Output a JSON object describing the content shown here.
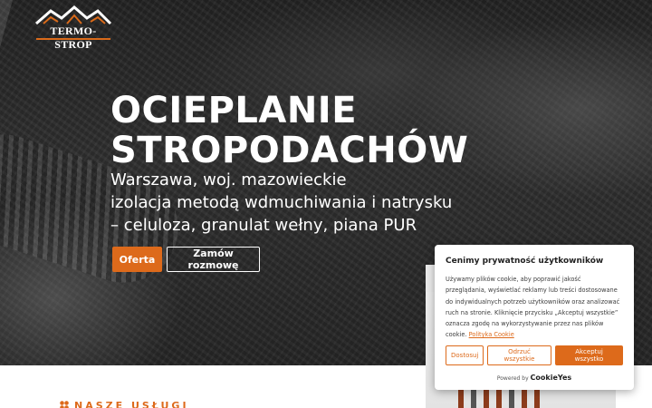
{
  "logo": {
    "text": "TERMO-STROP"
  },
  "hero": {
    "title_line1": "OCIEPLANIE",
    "title_line2": "STROPODACHÓW",
    "subtitle": [
      "Warszawa, woj. mazowieckie",
      "izolacja metodą wdmuchiwania i natrysku",
      "– celuloza, granulat wełny, piana PUR"
    ],
    "primary_button": "Oferta",
    "secondary_button": "Zamów rozmowę"
  },
  "services": {
    "heading": "NASZE USŁUGI"
  },
  "cookie_banner": {
    "title": "Cenimy prywatność użytkowników",
    "body": "Używamy plików cookie, aby poprawić jakość przeglądania, wyświetlać reklamy lub treści dostosowane do indywidualnych potrzeb użytkowników oraz analizować ruch na stronie. Kliknięcie przycisku „Akceptuj wszystkie” oznacza zgodę na wykorzystywanie przez nas plików cookie.",
    "link": "Polityka Cookie",
    "btn_customize": "Dostosuj",
    "btn_reject": "Odrzuć wszystkie",
    "btn_accept": "Akceptuj wszystko",
    "powered_by": "Powered by",
    "powered_brand": "CookieYes"
  },
  "colors": {
    "accent": "#dd6a1b",
    "hero_bg": "#2f2f2f",
    "white": "#ffffff"
  }
}
